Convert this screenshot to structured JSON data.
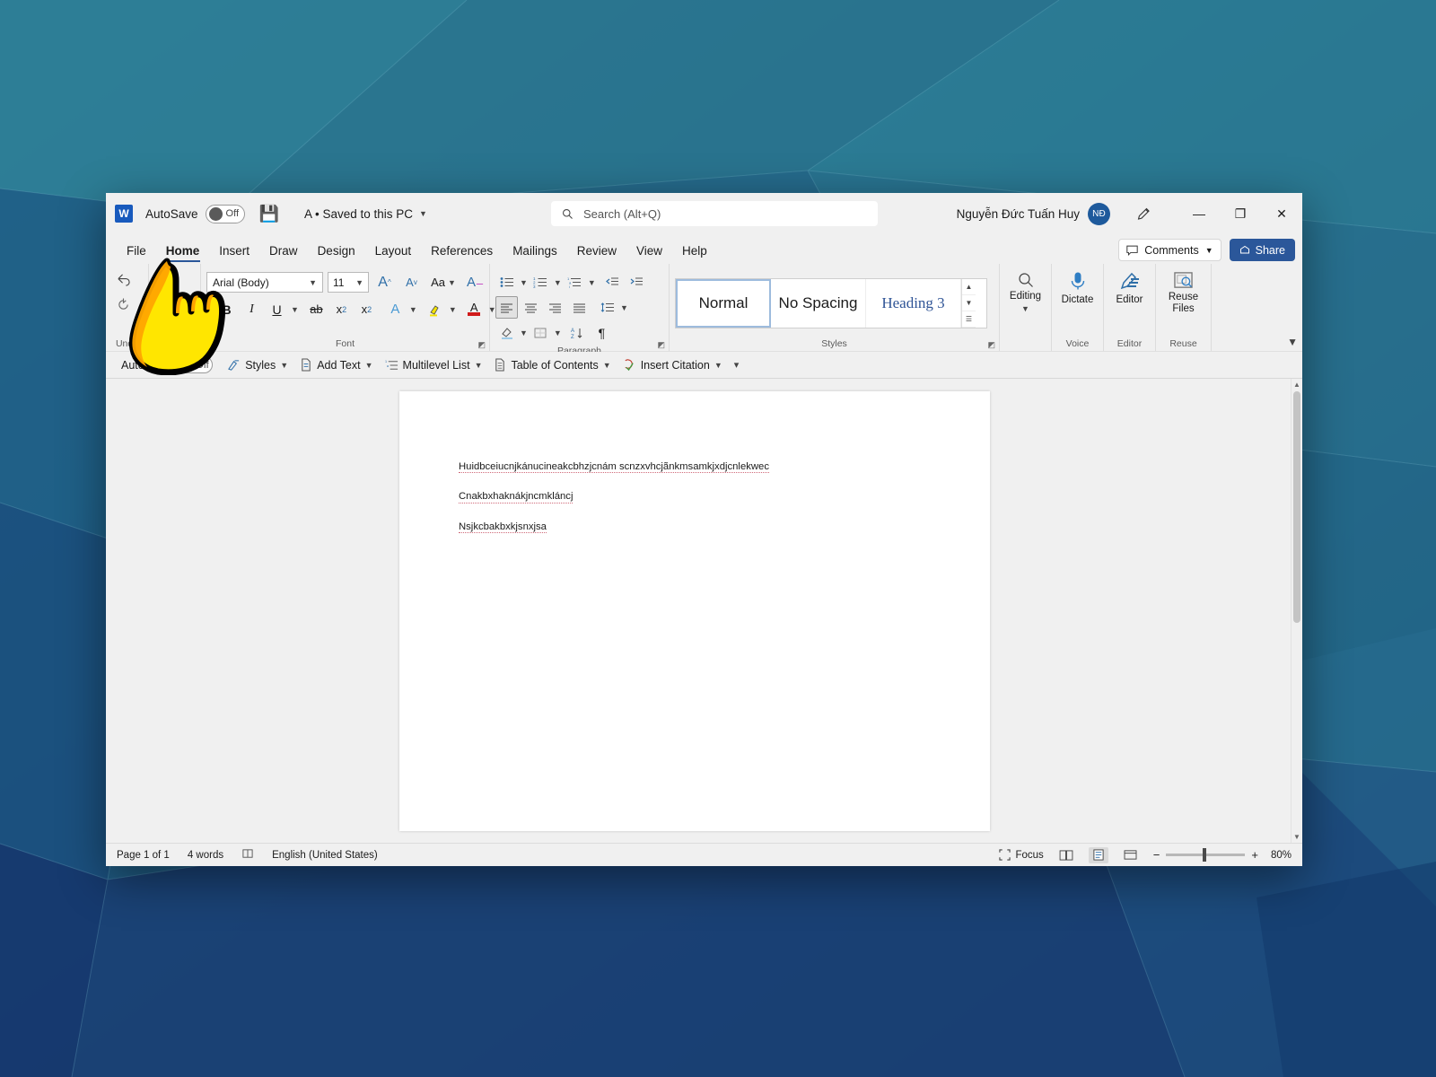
{
  "window": {
    "titlebar": {
      "app_logo": "word-logo",
      "autosave_label": "AutoSave",
      "autosave_state": "Off",
      "save_icon": "save-icon",
      "document_name": "A • Saved to this PC",
      "search_placeholder": "Search (Alt+Q)",
      "search_icon": "search-icon",
      "user_name": "Nguyễn Đức Tuấn Huy",
      "avatar_initials": "NĐ",
      "pen_icon": "pen-icon",
      "minimize": "—",
      "restore": "❐",
      "close": "✕"
    },
    "tabs": [
      {
        "label": "File",
        "active": false
      },
      {
        "label": "Home",
        "active": true
      },
      {
        "label": "Insert",
        "active": false
      },
      {
        "label": "Draw",
        "active": false
      },
      {
        "label": "Design",
        "active": false
      },
      {
        "label": "Layout",
        "active": false
      },
      {
        "label": "References",
        "active": false
      },
      {
        "label": "Mailings",
        "active": false
      },
      {
        "label": "Review",
        "active": false
      },
      {
        "label": "View",
        "active": false
      },
      {
        "label": "Help",
        "active": false
      }
    ],
    "comments_label": "Comments",
    "share_label": "Share"
  },
  "ribbon": {
    "groups": {
      "undo": {
        "label": "Undo"
      },
      "clipboard": {
        "label": ""
      },
      "font": {
        "label": "Font",
        "font_name": "Arial (Body)",
        "font_size": "11",
        "grow_font": "A",
        "shrink_font": "A",
        "change_case": "Aa",
        "clear_formatting": "A",
        "bold": "B",
        "italic": "I",
        "underline": "U",
        "strikethrough": "ab",
        "subscript": "x",
        "superscript": "x",
        "text_effects": "A",
        "highlight": "highlight-icon",
        "font_color": "A"
      },
      "paragraph": {
        "label": "Paragraph"
      },
      "styles": {
        "label": "Styles",
        "items": [
          {
            "name": "Normal",
            "selected": true
          },
          {
            "name": "No Spacing",
            "selected": false
          },
          {
            "name": "Heading 3",
            "selected": false
          }
        ]
      },
      "editing": {
        "label": "",
        "button": "Editing"
      },
      "voice": {
        "label": "Voice",
        "button": "Dictate"
      },
      "editor": {
        "label": "Editor",
        "button": "Editor"
      },
      "reuse_files": {
        "label": "Reuse Files",
        "button": "Reuse Files"
      }
    },
    "collapse_icon": "chevron-down-icon"
  },
  "toolbar2": {
    "autosave_label": "AutoSave",
    "autosave_state": "Off",
    "items": [
      {
        "label": "Styles",
        "icon": "styles-icon"
      },
      {
        "label": "Add Text",
        "icon": "add-text-icon"
      },
      {
        "label": "Multilevel List",
        "icon": "multilevel-list-icon"
      },
      {
        "label": "Table of Contents",
        "icon": "toc-icon"
      },
      {
        "label": "Insert Citation",
        "icon": "insert-citation-icon"
      }
    ],
    "overflow_icon": "overflow-icon"
  },
  "document": {
    "lines": [
      "Huidbceiucnjkánucineakcbhzjcnám scnzxvhcjãnkmsamkjxdjcnlekwec",
      "Cnakbxhaknákjncmkláncj",
      "Nsjkcbakbxkjsnxjsa"
    ]
  },
  "statusbar": {
    "page_info": "Page 1 of 1",
    "word_count": "4 words",
    "proofing_icon": "proofing-icon",
    "language": "English (United States)",
    "focus_label": "Focus",
    "views": [
      {
        "name": "read-mode",
        "active": false
      },
      {
        "name": "print-layout",
        "active": true
      },
      {
        "name": "web-layout",
        "active": false
      }
    ],
    "zoom_out": "−",
    "zoom_in": "+",
    "zoom_level": "80%"
  },
  "cursor": {
    "type": "pointing-hand-cursor",
    "color": "#FFE600"
  }
}
